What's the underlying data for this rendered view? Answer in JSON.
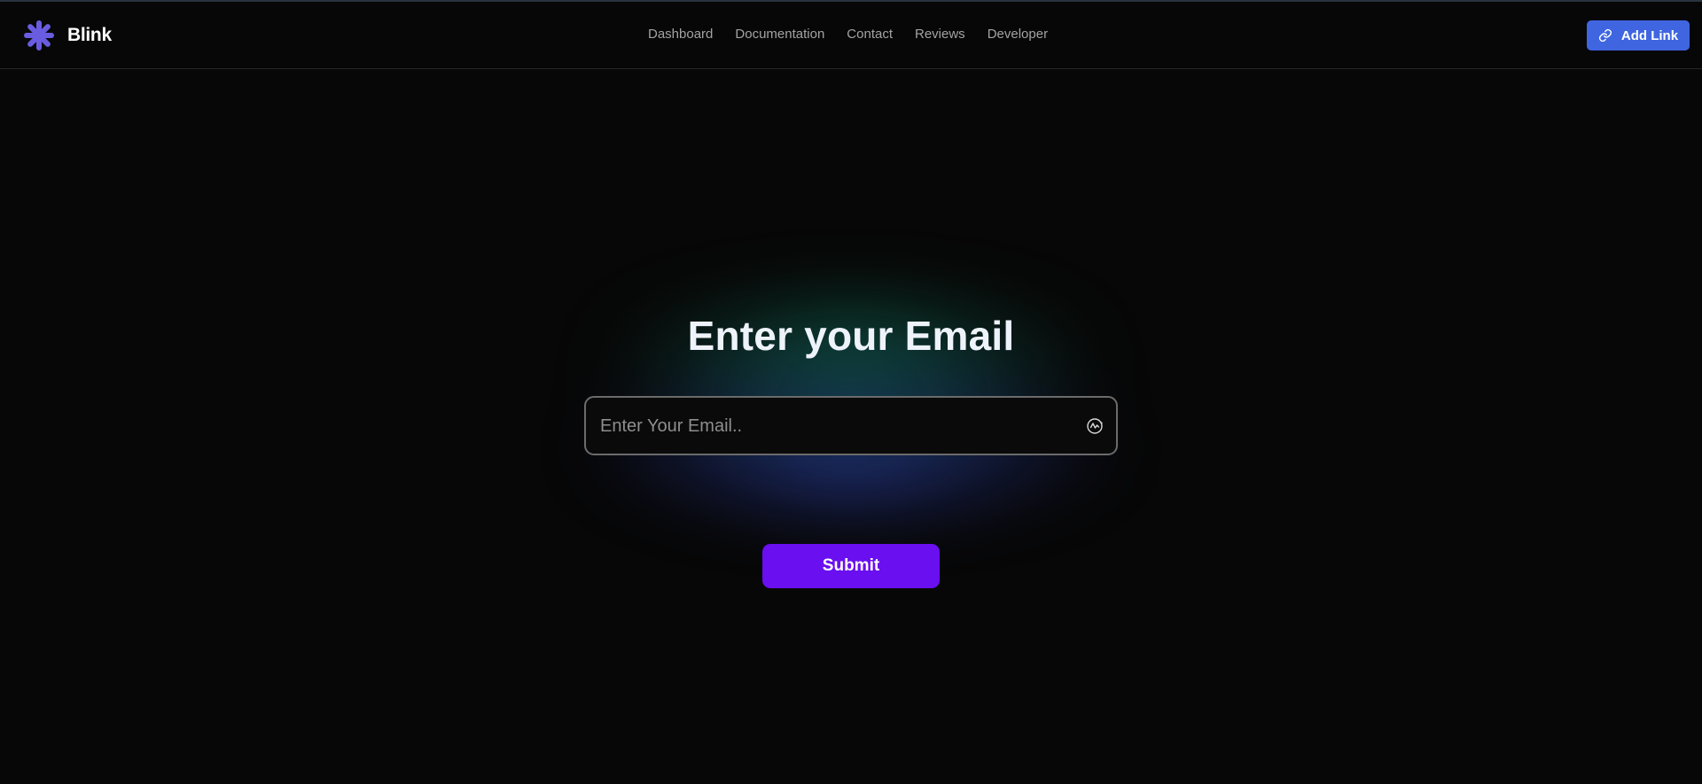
{
  "app": {
    "name": "Blink",
    "accent_color": "#6a5ce0",
    "logo_icon": "asterisk-icon"
  },
  "nav": {
    "items": [
      {
        "label": "Dashboard"
      },
      {
        "label": "Documentation"
      },
      {
        "label": "Contact"
      },
      {
        "label": "Reviews"
      },
      {
        "label": "Developer"
      }
    ]
  },
  "header": {
    "add_link_label": "Add Link",
    "add_link_icon": "link-icon",
    "add_link_color": "#3f66e0"
  },
  "hero": {
    "title": "Enter your Email",
    "email_placeholder": "Enter Your Email..",
    "email_value": "",
    "autofill_icon": "autofill-icon",
    "submit_label": "Submit",
    "submit_color": "#6a0ff0"
  }
}
